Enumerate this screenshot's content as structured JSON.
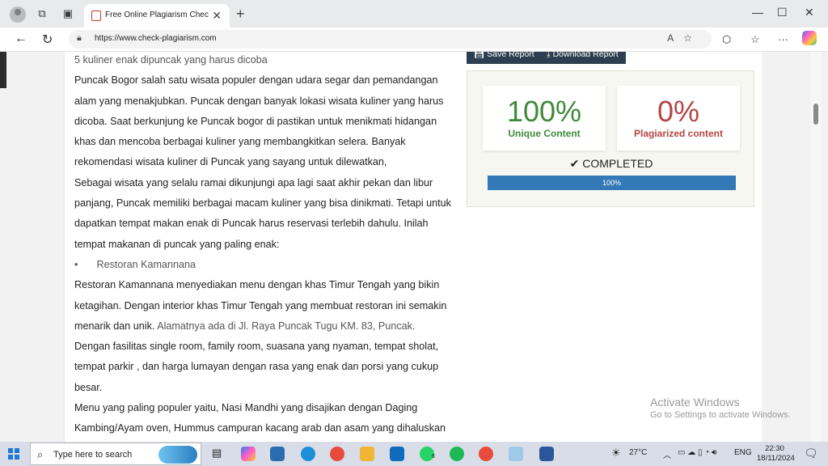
{
  "browser": {
    "tab_title": "Free Online Plagiarism Checker - C",
    "tab_close": "✕",
    "new_tab": "+",
    "url": "https://www.check-plagiarism.com",
    "window_controls": {
      "minimize": "—",
      "maximize": "☐",
      "close": "✕"
    }
  },
  "article": {
    "heading": "5 kuliner enak dipuncak yang harus dicoba",
    "paragraph1": "Puncak Bogor salah satu wisata populer dengan udara segar dan pemandangan alam yang menakjubkan. Puncak dengan banyak lokasi wisata kuliner yang harus dicoba. Saat berkunjung ke Puncak bogor di pastikan untuk menikmati hidangan khas dan mencoba berbagai kuliner yang membangkitkan selera. Banyak rekomendasi wisata kuliner di Puncak yang sayang untuk dilewatkan,",
    "paragraph2": "Sebagai wisata yang selalu ramai dikunjungi apa lagi saat akhir pekan dan libur panjang, Puncak memiliki berbagai macam kuliner yang bisa dinikmati. Tetapi untuk dapatkan tempat makan enak di Puncak harus reservasi terlebih dahulu. Inilah tempat makanan di puncak yang paling enak:",
    "bullet_marker": "•",
    "bullet1": "Restoran Kamannana",
    "paragraph3_a": "Restoran Kamannana menyediakan menu dengan khas Timur Tengah yang bikin ketagihan. Dengan interior khas Timur Tengah yang membuat restoran ini semakin menarik dan unik.",
    "paragraph3_b": "Alamatnya ada di Jl. Raya Puncak Tugu KM. 83, Puncak.",
    "paragraph3_c": "Dengan fasilitas single room, family room, suasana yang nyaman, tempat sholat, tempat parkir , dan harga lumayan dengan rasa yang enak dan porsi yang cukup besar.",
    "paragraph4": "Menu yang paling populer yaitu, Nasi Mandhi yang disajikan dengan Daging Kambing/Ayam oven, Hummus campuran kacang arab dan asam yang dihaluskan"
  },
  "report": {
    "save_button": "Save Report",
    "download_button": "Download Report",
    "unique_percent": "100%",
    "unique_label": "Unique Content",
    "plagiarized_percent": "0%",
    "plagiarized_label": "Plagiarized content",
    "status": "COMPLETED",
    "progress_label": "100%",
    "progress_value": 1.0,
    "colors": {
      "unique": "#3f8a3a",
      "plagiarized": "#b54444",
      "progress": "#3479b7",
      "buttons": "#2c3e50"
    }
  },
  "watermark": {
    "line1": "Activate Windows",
    "line2": "Go to Settings to activate Windows."
  },
  "taskbar": {
    "search_placeholder": "Type here to search",
    "weather": "27°C",
    "language": "ENG",
    "time": "22:30",
    "date": "18/11/2024",
    "whatsapp_badge": "6"
  }
}
